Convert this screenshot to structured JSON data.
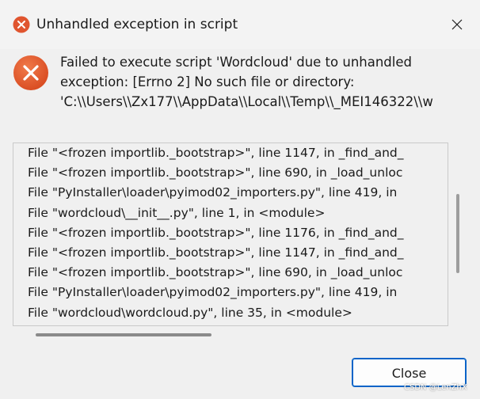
{
  "window": {
    "title": "Unhandled exception in script",
    "close_icon": "close-icon",
    "title_icon": "error-icon"
  },
  "message": {
    "lines": [
      "Failed to execute script 'Wordcloud' due to unhandled",
      "exception: [Errno 2] No such file or directory:",
      "'C:\\\\Users\\\\Zx177\\\\AppData\\\\Local\\\\Temp\\\\_MEI146322\\\\w"
    ]
  },
  "details": {
    "lines": [
      "File \"<frozen importlib._bootstrap>\", line 1147, in _find_and_",
      "File \"<frozen importlib._bootstrap>\", line 690, in _load_unloc",
      "File \"PyInstaller\\loader\\pyimod02_importers.py\", line 419, in",
      "File \"wordcloud\\__init__.py\", line 1, in <module>",
      "File \"<frozen importlib._bootstrap>\", line 1176, in _find_and_",
      "File \"<frozen importlib._bootstrap>\", line 1147, in _find_and_",
      "File \"<frozen importlib._bootstrap>\", line 690, in _load_unloc",
      "File \"PyInstaller\\loader\\pyimod02_importers.py\", line 419, in",
      "File \"wordcloud\\wordcloud.py\", line 35, in <module>"
    ]
  },
  "buttons": {
    "close_label": "Close"
  },
  "watermark": "CSDN @LenZhX",
  "colors": {
    "error_red": "#e0552f",
    "accent": "#0a64c8"
  }
}
